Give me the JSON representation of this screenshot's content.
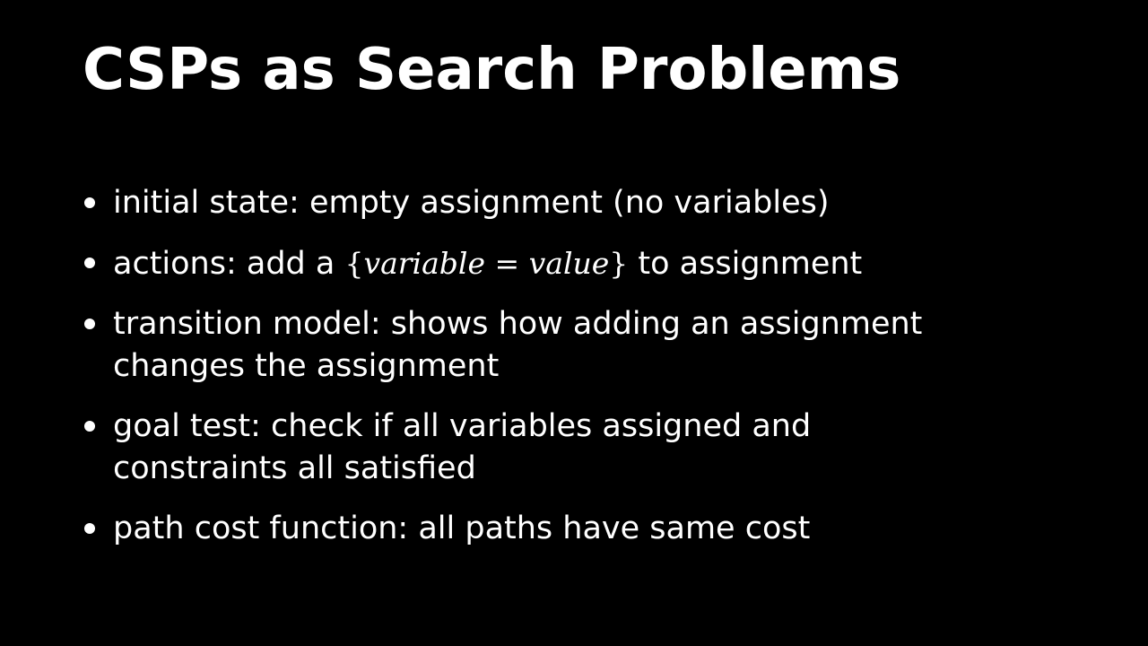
{
  "slide": {
    "title": "CSPs as Search Problems",
    "bullets": [
      {
        "text_line1": "initial state: empty assignment (no variables)"
      },
      {
        "prefix": "actions: add a ",
        "math": {
          "open": "{",
          "left": "variable",
          "eq": " = ",
          "right": "value",
          "close": "}"
        },
        "suffix": " to assignment"
      },
      {
        "text_line1": "transition model: shows how adding an assignment",
        "text_line2": "changes the assignment"
      },
      {
        "text_line1": "goal test: check if all variables assigned and",
        "text_line2": "constraints all satisfied"
      },
      {
        "text_line1": "path cost function: all paths have same cost"
      }
    ],
    "colors": {
      "background": "#000000",
      "text": "#ffffff"
    },
    "icons": {
      "bullet": "bullet-dot-icon"
    }
  }
}
